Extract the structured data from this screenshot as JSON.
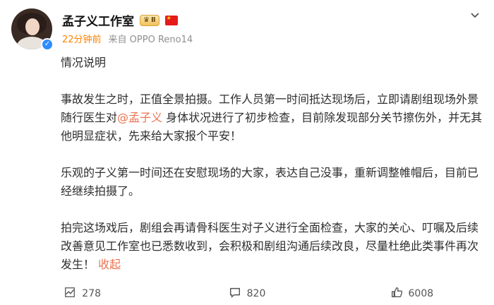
{
  "header": {
    "name": "孟子义工作室",
    "badge_label": "Ⅱ",
    "time": "22分钟前",
    "source": "来自 OPPO Reno14"
  },
  "post": {
    "paragraphs": [
      {
        "text": "情况说明"
      },
      {
        "before": "事故发生之时，正值全景拍摄。工作人员第一时间抵达现场后，立即请剧组现场外景随行医生对",
        "mention": "@孟子义",
        "after": " 身体状况进行了初步检查，目前除发现部分关节擦伤外，并无其他明显症状，先来给大家报个平安！"
      },
      {
        "text": "乐观的子义第一时间还在安慰现场的大家，表达自己没事，重新调整帷帽后，目前已经继续拍摄了。"
      },
      {
        "text": "拍完这场戏后，剧组会再请骨科医生对子义进行全面检查，大家的关心、叮嘱及后续改善意见工作室也已悉数收到，会积极和剧组沟通后续改良，尽量杜绝此类事件再次发生！",
        "collapse": "收起"
      }
    ]
  },
  "actions": {
    "repost": "278",
    "comment": "820",
    "like": "6008"
  },
  "colors": {
    "time": "#ff8200",
    "link": "#eb7350",
    "verified": "#2f8cff"
  },
  "icons": [
    "more-icon",
    "verified-icon",
    "repost-icon",
    "comment-icon",
    "like-icon"
  ]
}
